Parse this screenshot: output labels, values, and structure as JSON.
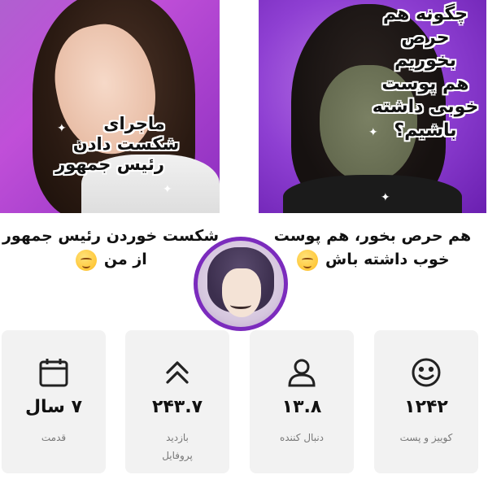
{
  "thumbnails": [
    {
      "overlay_lines": [
        "ماجرای",
        "شکست دادن",
        "رئیس جمهور"
      ],
      "caption_line1": "شکست خوردن رئیس جمهور",
      "caption_line2": "از من"
    },
    {
      "overlay_lines": [
        "چگونه هم",
        "حرص",
        "بخوریم",
        "هم پوست",
        "خوبی داشته",
        "باشیم؟"
      ],
      "caption_line1": "هم حرص بخور، هم پوست",
      "caption_line2": "خوب داشته باش"
    }
  ],
  "profile": {
    "avatar_icon": "anime-character-avatar"
  },
  "stats": [
    {
      "icon": "calendar-icon",
      "value": "۷ سال",
      "label": "قدمت",
      "label2": ""
    },
    {
      "icon": "chevron-double-up-icon",
      "value": "۲۴۳.۷",
      "label": "بازدید",
      "label2": "پروفایل"
    },
    {
      "icon": "user-icon",
      "value": "۱۳.۸",
      "label": "دنبال کننده",
      "label2": ""
    },
    {
      "icon": "smiley-icon",
      "value": "۱۲۴۲",
      "label": "کوییز و پست",
      "label2": ""
    }
  ]
}
